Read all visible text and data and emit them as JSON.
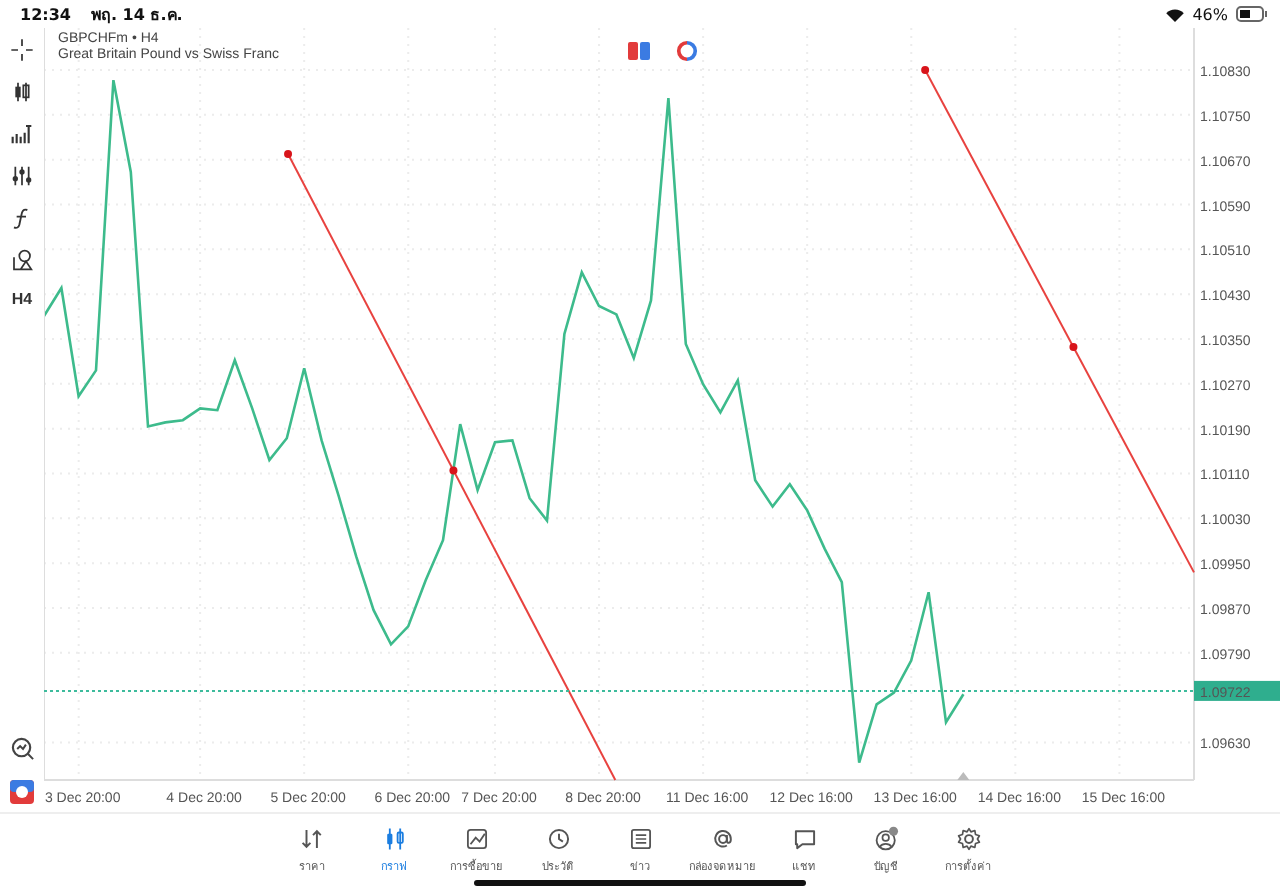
{
  "status_bar": {
    "time": "12:34",
    "date": "พฤ. 14 ธ.ค.",
    "battery": "46%"
  },
  "left_toolbar": {
    "timeframe_button": "H4"
  },
  "chart_header": {
    "separator": "•",
    "timeframe": "H4",
    "description": "Great Britain Pound vs Swiss Franc"
  },
  "chart": {
    "chart_data": {
      "type": "line",
      "grid": true,
      "ylim": [
        1.09563,
        1.10905
      ],
      "categories": [
        null,
        null,
        "3 Dec 20:00",
        null,
        null,
        null,
        null,
        null,
        null,
        "4 Dec 20:00",
        null,
        null,
        null,
        null,
        null,
        "5 Dec 20:00",
        null,
        null,
        null,
        null,
        null,
        "6 Dec 20:00",
        null,
        null,
        null,
        null,
        "7 Dec 20:00",
        null,
        null,
        null,
        null,
        null,
        "8 Dec 20:00",
        null,
        null,
        null,
        null,
        null,
        "11 Dec 16:00",
        null,
        null,
        null,
        null,
        null,
        "12 Dec 16:00",
        null,
        null,
        null,
        null,
        null,
        "13 Dec 16:00",
        null,
        null,
        null,
        null,
        null,
        "14 Dec 16:00",
        null,
        null,
        null,
        null,
        null,
        "15 Dec 16:00",
        null,
        null,
        null,
        null
      ],
      "series": [
        {
          "name": "GBPCHFm",
          "color": "#3dbb8c",
          "values": [
            1.10391,
            1.10441,
            1.10248,
            1.10294,
            1.10812,
            1.10648,
            1.10194,
            1.10201,
            1.10205,
            1.10226,
            1.10223,
            1.10312,
            1.10226,
            1.10134,
            1.10173,
            1.10298,
            1.10169,
            1.10069,
            1.09962,
            1.09866,
            1.09805,
            1.09837,
            1.09919,
            1.09991,
            1.10198,
            1.1008,
            1.10166,
            1.10169,
            1.10066,
            1.10026,
            1.10359,
            1.10469,
            1.10409,
            1.10394,
            1.10316,
            1.10419,
            1.1078,
            1.10341,
            1.10269,
            1.10219,
            1.10276,
            1.10098,
            1.10051,
            1.10091,
            1.10044,
            1.09976,
            1.09916,
            1.09594,
            1.09698,
            1.09719,
            1.09776,
            1.09898,
            1.09666,
            1.09716,
            null,
            null,
            null,
            null,
            null,
            null,
            null,
            null,
            null,
            null,
            null,
            null,
            null
          ]
        }
      ],
      "yticks": [
        {
          "value": 1.1083,
          "label": "1.10830"
        },
        {
          "value": 1.1075,
          "label": "1.10750"
        },
        {
          "value": 1.1067,
          "label": "1.10670"
        },
        {
          "value": 1.1059,
          "label": "1.10590"
        },
        {
          "value": 1.1051,
          "label": "1.10510"
        },
        {
          "value": 1.1043,
          "label": "1.10430"
        },
        {
          "value": 1.1035,
          "label": "1.10350"
        },
        {
          "value": 1.1027,
          "label": "1.10270"
        },
        {
          "value": 1.1019,
          "label": "1.10190"
        },
        {
          "value": 1.1011,
          "label": "1.10110"
        },
        {
          "value": 1.1003,
          "label": "1.10030"
        },
        {
          "value": 1.0995,
          "label": "1.09950"
        },
        {
          "value": 1.0987,
          "label": "1.09870"
        },
        {
          "value": 1.0979,
          "label": "1.09790"
        },
        {
          "value": 1.0963,
          "label": "1.09630"
        }
      ]
    },
    "current_price": "1.09722",
    "drawings": [
      {
        "kind": "trendline"
      },
      {
        "kind": "trendline"
      }
    ]
  },
  "tabs": [
    {
      "label": "ราคา",
      "selected": false
    },
    {
      "label": "กราฟ",
      "selected": true
    },
    {
      "label": "การซื้อขาย",
      "selected": false
    },
    {
      "label": "ประวัติ",
      "selected": false
    },
    {
      "label": "ข่าว",
      "selected": false
    },
    {
      "label": "กล่องจดหมาย",
      "selected": false
    },
    {
      "label": "แชท",
      "selected": false
    },
    {
      "label": "บัญชี",
      "selected": false
    },
    {
      "label": "การตั้งค่า",
      "selected": false
    }
  ]
}
